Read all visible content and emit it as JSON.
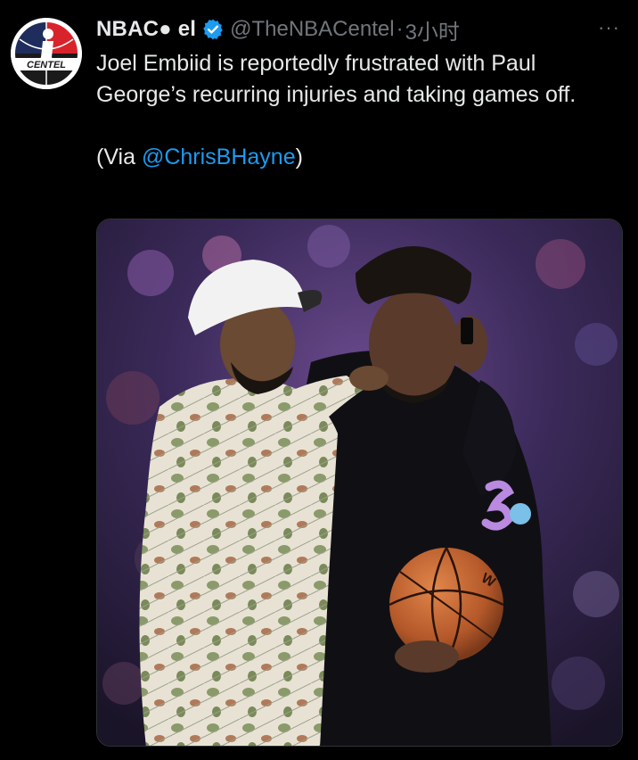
{
  "tweet": {
    "display_name": "NBAC● el",
    "handle": "@TheNBACentel",
    "separator": "·",
    "time": "3小时",
    "more_label": "···",
    "text_line": "Joel Embiid is reportedly frustrated with Paul George’s recurring injuries and taking games off.",
    "via_prefix": "(Via ",
    "via_mention": "@ChrisBHayne",
    "via_suffix": ")"
  },
  "avatar": {
    "logo_text": "CENTEL"
  },
  "media": {
    "ball_logo": "W"
  },
  "colors": {
    "background": "#000000",
    "text": "#e7e9ea",
    "muted": "#71767b",
    "link": "#1d9bf0",
    "verified": "#1d9bf0"
  }
}
